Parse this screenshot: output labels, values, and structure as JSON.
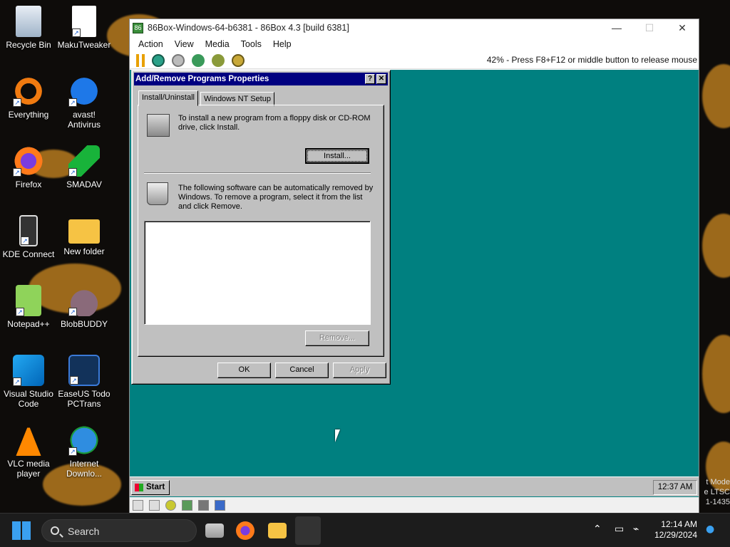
{
  "desktop": {
    "icons": [
      {
        "label": "Recycle Bin",
        "icon": "recycle-bin-icon"
      },
      {
        "label": "MakuTweaker",
        "icon": "file-icon"
      },
      {
        "label": "Everything",
        "icon": "search-icon"
      },
      {
        "label": "avast! Antivirus",
        "icon": "avast-icon"
      },
      {
        "label": "Firefox",
        "icon": "firefox-icon"
      },
      {
        "label": "SMADAV",
        "icon": "smadav-icon"
      },
      {
        "label": "KDE Connect",
        "icon": "phone-icon"
      },
      {
        "label": "New folder",
        "icon": "folder-icon"
      },
      {
        "label": "Notepad++",
        "icon": "notepad-icon"
      },
      {
        "label": "BlobBUDDY",
        "icon": "blob-icon"
      },
      {
        "label": "Visual Studio Code",
        "icon": "vscode-icon"
      },
      {
        "label": "EaseUS Todo PCTrans",
        "icon": "easeus-icon"
      },
      {
        "label": "VLC media player",
        "icon": "vlc-icon"
      },
      {
        "label": "Internet Downlo...",
        "icon": "idm-icon"
      }
    ],
    "watermark": [
      "t Mode",
      "e LTSC",
      "1-1435"
    ]
  },
  "emulator": {
    "title": "86Box-Windows-64-b6381 - 86Box 4.3 [build 6381]",
    "menu": [
      "Action",
      "View",
      "Media",
      "Tools",
      "Help"
    ],
    "status_message": "42% - Press F8+F12 or middle button to release mouse",
    "controls": {
      "minimize": "—",
      "maximize": "☐",
      "close": "✕"
    }
  },
  "dialog": {
    "title": "Add/Remove Programs Properties",
    "help_btn": "?",
    "close_btn": "✕",
    "tabs": [
      "Install/Uninstall",
      "Windows NT Setup"
    ],
    "install_text": "To install a new program from a floppy disk or CD-ROM drive, click Install.",
    "install_button": "Install...",
    "remove_text": "The following software can be automatically removed by Windows. To remove a program, select it from the list and click Remove.",
    "remove_button": "Remove...",
    "ok": "OK",
    "cancel": "Cancel",
    "apply": "Apply"
  },
  "guest_taskbar": {
    "start": "Start",
    "clock": "12:37 AM"
  },
  "host_taskbar": {
    "search_placeholder": "Search",
    "time": "12:14 AM",
    "date": "12/29/2024"
  }
}
